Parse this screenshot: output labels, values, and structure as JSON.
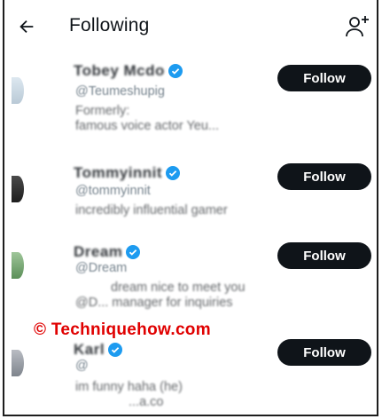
{
  "header": {
    "title": "Following",
    "back_icon": "arrow-left-icon",
    "add_icon": "person-plus-icon"
  },
  "colors": {
    "button_bg": "#0f1419",
    "button_text": "#ffffff",
    "verified": "#1d9bf0",
    "handle": "#536471",
    "watermark": "#e00000"
  },
  "accounts": [
    {
      "name": "Tobey Mcdo",
      "handle": "@Teumeshupig",
      "bio": [
        "Formerly:",
        "famous voice actor Yeu..."
      ],
      "verified": true,
      "follow_label": "Follow"
    },
    {
      "name": "Tommyinnit",
      "handle": "@tommyinnit",
      "bio": [
        "incredibly influential gamer"
      ],
      "verified": true,
      "follow_label": "Follow"
    },
    {
      "name": "Dream",
      "handle": "@Dream",
      "bio": [
        "dream nice to meet you",
        "@D... manager for inquiries"
      ],
      "verified": true,
      "follow_label": "Follow"
    },
    {
      "name": "Karl",
      "handle": "@",
      "bio": [
        "im funny haha (he)",
        "...a.co"
      ],
      "verified": true,
      "follow_label": "Follow"
    }
  ],
  "watermark": "© Techniquehow.com"
}
